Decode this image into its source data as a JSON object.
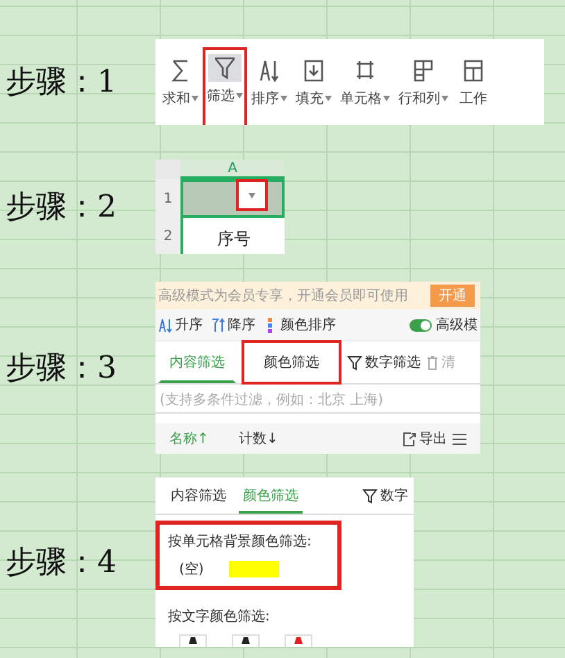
{
  "steps": [
    {
      "label": "步骤：1",
      "kind": "toolbar",
      "items": [
        {
          "label": "求和",
          "selected": false,
          "highlighted": false
        },
        {
          "label": "筛选",
          "selected": true,
          "highlighted": true
        },
        {
          "label": "排序",
          "selected": false,
          "highlighted": false
        },
        {
          "label": "填充",
          "selected": false,
          "highlighted": false
        },
        {
          "label": "单元格",
          "selected": false,
          "highlighted": false
        },
        {
          "label": "行和列",
          "selected": false,
          "highlighted": false
        },
        {
          "label": "工作",
          "selected": false,
          "highlighted": false
        }
      ]
    },
    {
      "label": "步骤：2",
      "kind": "sheet",
      "column": "A",
      "rows": [
        "1",
        "2"
      ],
      "cell": "序号",
      "filter_button": {
        "highlighted": true
      }
    },
    {
      "label": "步骤：3",
      "kind": "filter_panel",
      "banner": {
        "text": "高级模式为会员专享，开通会员即可使用",
        "button": "开通"
      },
      "sort_buttons": [
        "升序",
        "降序",
        "颜色排序"
      ],
      "advanced": {
        "label": "高级模",
        "on": true
      },
      "tabs": [
        {
          "label": "内容筛选",
          "selected": true,
          "highlighted": false
        },
        {
          "label": "颜色筛选",
          "selected": false,
          "highlighted": true
        }
      ],
      "actions": [
        "数字筛选",
        "清"
      ],
      "search": {
        "placeholder": "(支持多条件过滤，例如：北京 上海)"
      },
      "columns": [
        "名称↑",
        "计数↓"
      ],
      "tools": [
        "导出"
      ]
    },
    {
      "label": "步骤：4",
      "kind": "color_filter",
      "tabs": [
        {
          "label": "内容筛选",
          "selected": false
        },
        {
          "label": "颜色筛选",
          "selected": true
        }
      ],
      "action": "数字",
      "sections": [
        {
          "title": "按单元格背景颜色筛选:",
          "highlighted": true,
          "options": [
            {
              "label": "(空)"
            },
            {
              "color": "#ffff00"
            }
          ]
        },
        {
          "title": "按文字颜色筛选:",
          "highlighted": false,
          "options": [
            {
              "color": "#222222"
            },
            {
              "color": "#222222"
            },
            {
              "color": "#e02020"
            }
          ]
        }
      ]
    }
  ]
}
